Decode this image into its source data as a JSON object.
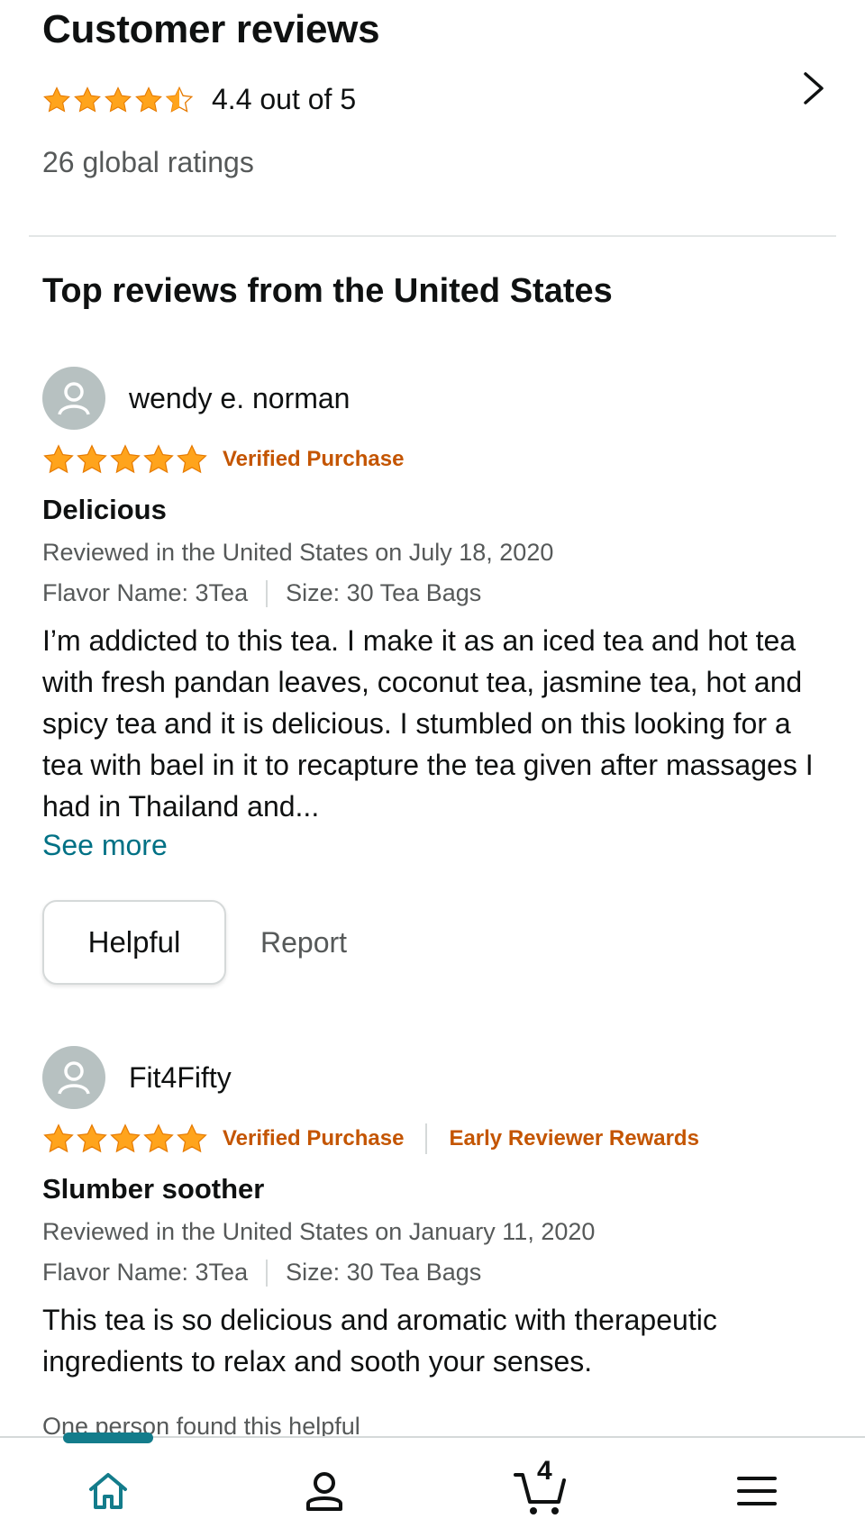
{
  "summary": {
    "title": "Customer reviews",
    "rating_value": 4.4,
    "rating_text": "4.4 out of 5",
    "global_ratings": "26 global ratings"
  },
  "section_title": "Top reviews from the United States",
  "reviews": [
    {
      "reviewer": "wendy e. norman",
      "stars": 5,
      "badges": [
        "Verified Purchase"
      ],
      "title": "Delicious",
      "date": "Reviewed in the United States on July 18, 2020",
      "flavor": "Flavor Name: 3Tea",
      "size": "Size: 30 Tea Bags",
      "body": "I’m addicted to this tea. I make it as an iced tea and hot tea with fresh pandan leaves, coconut tea, jasmine tea, hot and spicy tea and it is delicious. I stumbled on this looking for a tea with bael in it to recapture the tea given after massages I had in Thailand and...",
      "see_more": "See more",
      "helpful_label": "Helpful",
      "report_label": "Report"
    },
    {
      "reviewer": "Fit4Fifty",
      "stars": 5,
      "badges": [
        "Verified Purchase",
        "Early Reviewer Rewards"
      ],
      "title": "Slumber soother",
      "date": "Reviewed in the United States on January 11, 2020",
      "flavor": "Flavor Name: 3Tea",
      "size": "Size: 30 Tea Bags",
      "body": "This tea is so delicious and aromatic with therapeutic ingredients to relax and sooth your senses.",
      "helpful_count": "One person found this helpful"
    }
  ],
  "bottom_nav": {
    "items": [
      "home-icon",
      "account-icon",
      "cart-icon",
      "menu-icon"
    ],
    "cart_count": "4",
    "active_color": "#137c8b"
  },
  "colors": {
    "star": "#ffa41c",
    "badge": "#c45500",
    "link": "#007185"
  }
}
